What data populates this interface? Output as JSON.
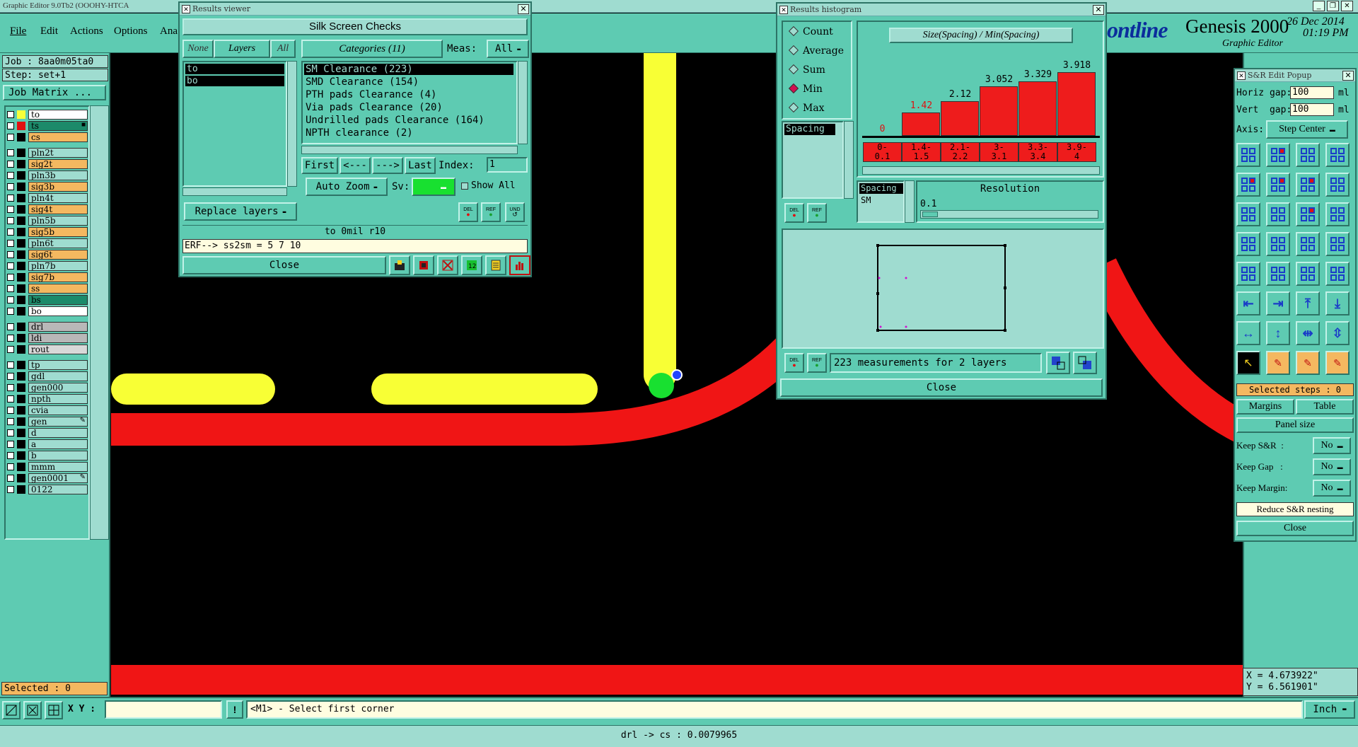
{
  "app": {
    "window_title": "Graphic Editor 9.0Tb2 (OOOHY-HTCA",
    "brand": "ontline",
    "product": "Genesis 2000",
    "subtitle": "Graphic Editor",
    "date": "26 Dec 2014",
    "time": "01:19 PM"
  },
  "menu": [
    "File",
    "Edit",
    "Actions",
    "Options",
    "Ana"
  ],
  "job": {
    "job_label": "Job : 8aa0m05ta0",
    "step_label": "Step: set+1",
    "matrix_button": "Job Matrix ..."
  },
  "layers": [
    {
      "name": "to",
      "color": "#f6ff3a",
      "bg": "#ffffff",
      "swatch": "#f6ff3a"
    },
    {
      "name": "ts",
      "color": "#e01010",
      "bg": "#1c8a6a",
      "swatch": "#e01010",
      "flag": "■"
    },
    {
      "name": "cs",
      "color": "#000",
      "bg": "#f4b860",
      "swatch": "#000"
    },
    {
      "name": "pln2t",
      "color": "#000",
      "bg": "#9fdcd0",
      "swatch": "#000"
    },
    {
      "name": "sig2t",
      "color": "#000",
      "bg": "#f4b860",
      "swatch": "#000"
    },
    {
      "name": "pln3b",
      "color": "#000",
      "bg": "#9fdcd0",
      "swatch": "#000"
    },
    {
      "name": "sig3b",
      "color": "#000",
      "bg": "#f4b860",
      "swatch": "#000"
    },
    {
      "name": "pln4t",
      "color": "#000",
      "bg": "#9fdcd0",
      "swatch": "#000"
    },
    {
      "name": "sig4t",
      "color": "#000",
      "bg": "#f4b860",
      "swatch": "#000"
    },
    {
      "name": "pln5b",
      "color": "#000",
      "bg": "#9fdcd0",
      "swatch": "#000"
    },
    {
      "name": "sig5b",
      "color": "#000",
      "bg": "#f4b860",
      "swatch": "#000"
    },
    {
      "name": "pln6t",
      "color": "#000",
      "bg": "#9fdcd0",
      "swatch": "#000"
    },
    {
      "name": "sig6t",
      "color": "#000",
      "bg": "#f4b860",
      "swatch": "#000"
    },
    {
      "name": "pln7b",
      "color": "#000",
      "bg": "#9fdcd0",
      "swatch": "#000"
    },
    {
      "name": "sig7b",
      "color": "#000",
      "bg": "#f4b860",
      "swatch": "#000"
    },
    {
      "name": "ss",
      "color": "#000",
      "bg": "#f4b860",
      "swatch": "#000"
    },
    {
      "name": "bs",
      "color": "#000",
      "bg": "#1c8a6a",
      "swatch": "#000"
    },
    {
      "name": "bo",
      "color": "#000",
      "bg": "#ffffff",
      "swatch": "#000"
    },
    {
      "name": "drl",
      "color": "#000",
      "bg": "#b8b8b8",
      "swatch": "#000"
    },
    {
      "name": "ldi",
      "color": "#000",
      "bg": "#b8b8b8",
      "swatch": "#000"
    },
    {
      "name": "rout",
      "color": "#000",
      "bg": "#d8d8d8",
      "swatch": "#000"
    },
    {
      "name": "tp",
      "color": "#000",
      "bg": "#9fdcd0",
      "swatch": "#000"
    },
    {
      "name": "gdl",
      "color": "#000",
      "bg": "#9fdcd0",
      "swatch": "#000"
    },
    {
      "name": "gen000",
      "color": "#000",
      "bg": "#9fdcd0",
      "swatch": "#000"
    },
    {
      "name": "npth",
      "color": "#000",
      "bg": "#9fdcd0",
      "swatch": "#000"
    },
    {
      "name": "cvia",
      "color": "#000",
      "bg": "#9fdcd0",
      "swatch": "#000"
    },
    {
      "name": "gen",
      "color": "#000",
      "bg": "#9fdcd0",
      "swatch": "#000",
      "flag": "✎"
    },
    {
      "name": "d",
      "color": "#000",
      "bg": "#9fdcd0",
      "swatch": "#000"
    },
    {
      "name": "a",
      "color": "#000",
      "bg": "#9fdcd0",
      "swatch": "#000"
    },
    {
      "name": "b",
      "color": "#000",
      "bg": "#9fdcd0",
      "swatch": "#000"
    },
    {
      "name": "mmm",
      "color": "#000",
      "bg": "#9fdcd0",
      "swatch": "#000"
    },
    {
      "name": "gen0001",
      "color": "#000",
      "bg": "#9fdcd0",
      "swatch": "#000",
      "flag": "✎"
    },
    {
      "name": "0122",
      "color": "#000",
      "bg": "#9fdcd0",
      "swatch": "#000"
    }
  ],
  "selected": "Selected : 0",
  "results_viewer": {
    "title": "Results viewer",
    "heading": "Silk Screen Checks",
    "none_btn": "None",
    "layers_btn": "Layers",
    "all_btn": "All",
    "categories_btn": "Categories (11)",
    "meas_label": "Meas:",
    "meas_value": "All",
    "layer_list": [
      "to",
      "bo"
    ],
    "categories": [
      "SM Clearance (223)",
      "SMD Clearance (154)",
      "PTH pads Clearance (4)",
      "Via pads Clearance (20)",
      "Undrilled pads Clearance (164)",
      "NPTH clearance (2)"
    ],
    "nav": {
      "first": "First",
      "prev": "<---",
      "next": "--->",
      "last": "Last",
      "index_label": "Index:",
      "index_value": "1"
    },
    "auto_zoom": "Auto Zoom",
    "sv_label": "Sv:",
    "show_all": "Show All",
    "replace_layers": "Replace layers",
    "del": "DEL",
    "ref": "REF",
    "und": "UND",
    "status": "to 0mil  r10",
    "erf": "ERF--> ss2sm = 5 7 10",
    "close": "Close"
  },
  "histogram": {
    "title": "Results histogram",
    "chart_title": "Size(Spacing) / Min(Spacing)",
    "modes": [
      {
        "label": "Count",
        "on": false
      },
      {
        "label": "Average",
        "on": false
      },
      {
        "label": "Sum",
        "on": false
      },
      {
        "label": "Min",
        "on": true
      },
      {
        "label": "Max",
        "on": false
      }
    ],
    "meas_list": [
      "Spacing"
    ],
    "bars": [
      {
        "value": "0",
        "range": "0-\n0.1",
        "ratio": 0
      },
      {
        "value": "1.42",
        "range": "1.4-\n1.5",
        "ratio": 0.362
      },
      {
        "value": "2.12",
        "range": "2.1-\n2.2",
        "ratio": 0.541
      },
      {
        "value": "3.052",
        "range": "3-\n3.1",
        "ratio": 0.779
      },
      {
        "value": "3.329",
        "range": "3.3-\n3.4",
        "ratio": 0.85
      },
      {
        "value": "3.918",
        "range": "3.9-\n4",
        "ratio": 1
      }
    ],
    "sel_list": [
      "Spacing",
      "SM"
    ],
    "resolution_label": "Resolution",
    "resolution_value": "0.1",
    "del": "DEL",
    "ref": "REF",
    "summary": "223 measurements for 2 layers",
    "close": "Close"
  },
  "sr_popup": {
    "title": "S&R Edit Popup",
    "horiz_label": "Horiz gap:",
    "horiz_value": "100",
    "vert_label": "Vert  gap:",
    "vert_value": "100",
    "unit": "ml",
    "axis_label": "Axis:",
    "axis_value": "Step Center",
    "selected_steps": "Selected steps : 0",
    "margins": "Margins",
    "table": "Table",
    "panel_size": "Panel size",
    "keep_sr_label": "Keep S&R  :",
    "keep_sr_value": "No",
    "keep_gap_label": "Keep Gap   :",
    "keep_gap_value": "No",
    "keep_margin_label": "Keep Margin:",
    "keep_margin_value": "No",
    "reduce": "Reduce S&R nesting",
    "close": "Close"
  },
  "coords": {
    "x": "X = 4.673922\"",
    "y": "Y = 6.561901\""
  },
  "bottom": {
    "xy_label": "X Y :",
    "xy_value": "",
    "prompt": "<M1> - Select first corner",
    "units": "Inch",
    "status": "drl -> cs : 0.0079965"
  }
}
